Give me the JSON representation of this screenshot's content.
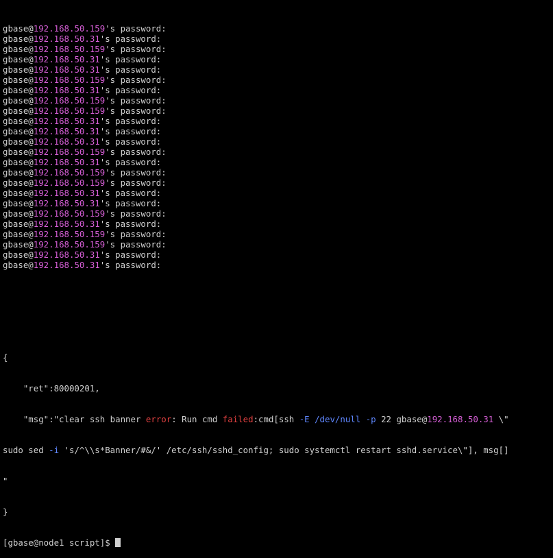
{
  "prompts": [
    {
      "user": "gbase",
      "ip": "192.168.50.159",
      "suffix": "'s password:"
    },
    {
      "user": "gbase",
      "ip": "192.168.50.31",
      "suffix": "'s password:"
    },
    {
      "user": "gbase",
      "ip": "192.168.50.159",
      "suffix": "'s password:"
    },
    {
      "user": "gbase",
      "ip": "192.168.50.31",
      "suffix": "'s password:"
    },
    {
      "user": "gbase",
      "ip": "192.168.50.31",
      "suffix": "'s password:"
    },
    {
      "user": "gbase",
      "ip": "192.168.50.159",
      "suffix": "'s password:"
    },
    {
      "user": "gbase",
      "ip": "192.168.50.31",
      "suffix": "'s password:"
    },
    {
      "user": "gbase",
      "ip": "192.168.50.159",
      "suffix": "'s password:"
    },
    {
      "user": "gbase",
      "ip": "192.168.50.159",
      "suffix": "'s password:"
    },
    {
      "user": "gbase",
      "ip": "192.168.50.31",
      "suffix": "'s password:"
    },
    {
      "user": "gbase",
      "ip": "192.168.50.31",
      "suffix": "'s password:"
    },
    {
      "user": "gbase",
      "ip": "192.168.50.31",
      "suffix": "'s password:"
    },
    {
      "user": "gbase",
      "ip": "192.168.50.159",
      "suffix": "'s password:"
    },
    {
      "user": "gbase",
      "ip": "192.168.50.31",
      "suffix": "'s password:"
    },
    {
      "user": "gbase",
      "ip": "192.168.50.159",
      "suffix": "'s password:"
    },
    {
      "user": "gbase",
      "ip": "192.168.50.159",
      "suffix": "'s password:"
    },
    {
      "user": "gbase",
      "ip": "192.168.50.31",
      "suffix": "'s password:"
    },
    {
      "user": "gbase",
      "ip": "192.168.50.31",
      "suffix": "'s password:"
    },
    {
      "user": "gbase",
      "ip": "192.168.50.159",
      "suffix": "'s password:"
    },
    {
      "user": "gbase",
      "ip": "192.168.50.31",
      "suffix": "'s password:"
    },
    {
      "user": "gbase",
      "ip": "192.168.50.159",
      "suffix": "'s password:"
    },
    {
      "user": "gbase",
      "ip": "192.168.50.159",
      "suffix": "'s password:"
    },
    {
      "user": "gbase",
      "ip": "192.168.50.31",
      "suffix": "'s password:"
    },
    {
      "user": "gbase",
      "ip": "192.168.50.31",
      "suffix": "'s password:"
    }
  ],
  "result": {
    "open_brace": "{",
    "ret_line": "    \"ret\":80000201,",
    "msg_parts": [
      {
        "text": "    \"msg\":\"clear ssh banner ",
        "cls": ""
      },
      {
        "text": "error",
        "cls": "err"
      },
      {
        "text": ": Run cmd ",
        "cls": ""
      },
      {
        "text": "failed",
        "cls": "err"
      },
      {
        "text": ":cmd[ssh ",
        "cls": ""
      },
      {
        "text": "-E",
        "cls": "flag"
      },
      {
        "text": " ",
        "cls": ""
      },
      {
        "text": "/dev/null",
        "cls": "path"
      },
      {
        "text": " ",
        "cls": ""
      },
      {
        "text": "-p",
        "cls": "flag"
      },
      {
        "text": " 22 gbase@",
        "cls": ""
      },
      {
        "text": "192.168.50.31",
        "cls": "ip"
      },
      {
        "text": " \\\"",
        "cls": ""
      }
    ],
    "cont_parts": [
      {
        "text": "sudo sed ",
        "cls": ""
      },
      {
        "text": "-i",
        "cls": "flag"
      },
      {
        "text": " 's/^\\\\s*Banner/#&/' /etc/ssh/sshd_config; sudo systemctl restart sshd.service\\\"], msg[]",
        "cls": ""
      }
    ],
    "quote_line": "\"",
    "close_brace": "}"
  },
  "shell_prompt": "[gbase@node1 script]$ "
}
